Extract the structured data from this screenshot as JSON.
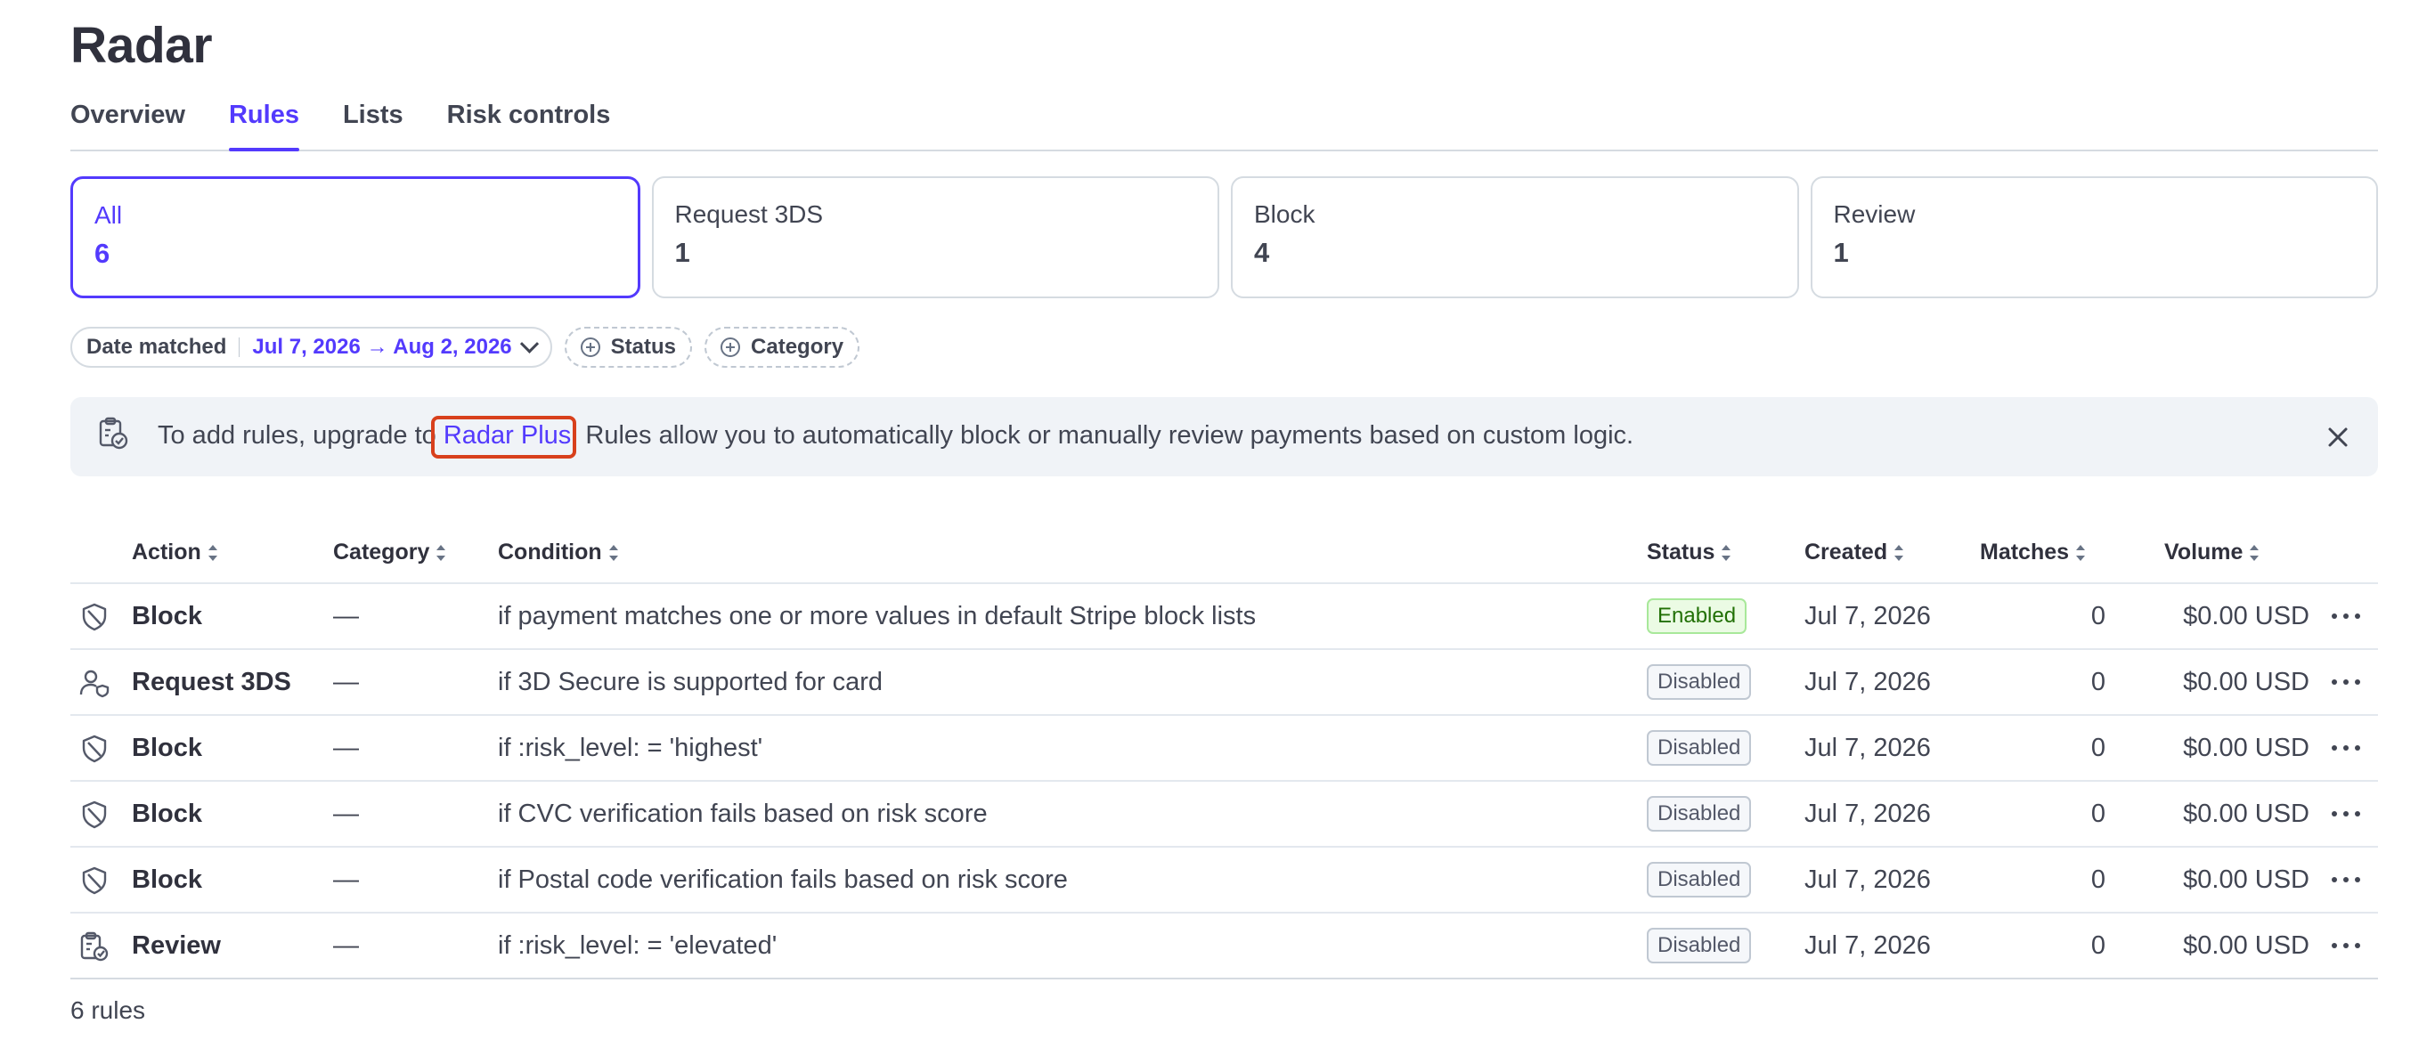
{
  "header": {
    "title": "Radar"
  },
  "tabs": [
    {
      "label": "Overview",
      "active": false
    },
    {
      "label": "Rules",
      "active": true
    },
    {
      "label": "Lists",
      "active": false
    },
    {
      "label": "Risk controls",
      "active": false
    }
  ],
  "summary_cards": [
    {
      "label": "All",
      "count": "6",
      "active": true
    },
    {
      "label": "Request 3DS",
      "count": "1",
      "active": false
    },
    {
      "label": "Block",
      "count": "4",
      "active": false
    },
    {
      "label": "Review",
      "count": "1",
      "active": false
    }
  ],
  "filters": {
    "date_label": "Date matched",
    "date_value": "Jul 7, 2026 → Aug 2, 2026",
    "status_label": "Status",
    "category_label": "Category"
  },
  "banner": {
    "prefix": "To add rules, upgrade to ",
    "link_text": "Radar Plus",
    "suffix": ". Rules allow you to automatically block or manually review payments based on custom logic."
  },
  "table": {
    "columns": {
      "action": "Action",
      "category": "Category",
      "condition": "Condition",
      "status": "Status",
      "created": "Created",
      "matches": "Matches",
      "volume": "Volume"
    },
    "rows": [
      {
        "icon": "shield-icon",
        "action": "Block",
        "category": "—",
        "condition": "if payment matches one or more values in default Stripe block lists",
        "status": "Enabled",
        "created": "Jul 7, 2026",
        "matches": "0",
        "volume": "$0.00 USD"
      },
      {
        "icon": "user-shield-icon",
        "action": "Request 3DS",
        "category": "—",
        "condition": "if 3D Secure is supported for card",
        "status": "Disabled",
        "created": "Jul 7, 2026",
        "matches": "0",
        "volume": "$0.00 USD"
      },
      {
        "icon": "shield-icon",
        "action": "Block",
        "category": "—",
        "condition": "if :risk_level: = 'highest'",
        "status": "Disabled",
        "created": "Jul 7, 2026",
        "matches": "0",
        "volume": "$0.00 USD"
      },
      {
        "icon": "shield-icon",
        "action": "Block",
        "category": "—",
        "condition": "if CVC verification fails based on risk score",
        "status": "Disabled",
        "created": "Jul 7, 2026",
        "matches": "0",
        "volume": "$0.00 USD"
      },
      {
        "icon": "shield-icon",
        "action": "Block",
        "category": "—",
        "condition": "if Postal code verification fails based on risk score",
        "status": "Disabled",
        "created": "Jul 7, 2026",
        "matches": "0",
        "volume": "$0.00 USD"
      },
      {
        "icon": "clipboard-check-icon",
        "action": "Review",
        "category": "—",
        "condition": "if :risk_level: = 'elevated'",
        "status": "Disabled",
        "created": "Jul 7, 2026",
        "matches": "0",
        "volume": "$0.00 USD"
      }
    ]
  },
  "footer": {
    "count_text": "6 rules"
  },
  "colors": {
    "accent": "#533afd",
    "highlight": "#d8401c",
    "enabled_bg": "#ebfbe4",
    "enabled_text": "#217005"
  }
}
